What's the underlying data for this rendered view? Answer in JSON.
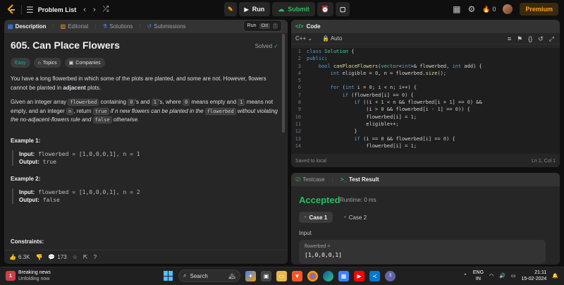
{
  "topbar": {
    "problem_list": "Problem List",
    "run": "Run",
    "submit": "Submit",
    "streak": "0",
    "premium": "Premium"
  },
  "left": {
    "tabs": [
      "Description",
      "Editorial",
      "Solutions",
      "Submissions"
    ],
    "run_hint": "Run",
    "run_key": "Ctrl",
    "title": "605. Can Place Flowers",
    "solved": "Solved",
    "chips": [
      "Easy",
      "Topics",
      "Companies"
    ],
    "para1_a": "You have a long flowerbed in which some of the plots are planted, and some are not. However, flowers cannot be planted in ",
    "para1_b": "adjacent",
    "para1_c": " plots.",
    "p2_1": "Given an integer array ",
    "p2_c1": "flowerbed",
    "p2_2": " containing ",
    "p2_c2": "0",
    "p2_3": "'s and ",
    "p2_c3": "1",
    "p2_4": "'s, where ",
    "p2_c4": "0",
    "p2_5": " means empty and ",
    "p2_c5": "1",
    "p2_6": " means not empty, and an integer ",
    "p2_c6": "n",
    "p2_7": ", return ",
    "p2_c7": "true",
    "p2_8": " if ",
    "p2_i1": "n",
    "p2_9": " new flowers can be planted in the ",
    "p2_c8": "flowerbed",
    "p2_10": " without violating the no-adjacent-flowers rule and ",
    "p2_c9": "false",
    "p2_11": " otherwise.",
    "ex1_title": "Example 1:",
    "ex1_input_label": "Input:",
    "ex1_input": "flowerbed = [1,0,0,0,1], n = 1",
    "ex1_output_label": "Output:",
    "ex1_output": "true",
    "ex2_title": "Example 2:",
    "ex2_input_label": "Input:",
    "ex2_input": "flowerbed = [1,0,0,0,1], n = 2",
    "ex2_output_label": "Output:",
    "ex2_output": "false",
    "constraints": "Constraints:",
    "likes": "6.3K",
    "comments": "173"
  },
  "code": {
    "header": "Code",
    "language": "C++",
    "mode": "Auto",
    "saved": "Saved to local",
    "cursor": "Ln 1, Col 1",
    "line_numbers": [
      "1",
      "2",
      "3",
      "4",
      "5",
      "6",
      "7",
      "8",
      "9",
      "10",
      "11",
      "12",
      "13",
      "14"
    ]
  },
  "result": {
    "tabs": [
      "Testcase",
      "Test Result"
    ],
    "status": "Accepted",
    "runtime": "Runtime: 0 ms",
    "cases": [
      "Case 1",
      "Case 2"
    ],
    "input_label": "Input",
    "var_name": "flowerbed =",
    "var_value": "[1,0,0,0,1]"
  },
  "taskbar": {
    "news_title": "Breaking news",
    "news_sub": "Unfolding now",
    "news_badge": "1",
    "search": "Search",
    "lang1": "ENG",
    "lang2": "IN",
    "time": "21:11",
    "date": "15-02-2024",
    "teams_badge": "3"
  },
  "colors": {
    "accent_green": "#2cbb5d",
    "premium": "#ffa116",
    "easy": "#00b8a3"
  }
}
